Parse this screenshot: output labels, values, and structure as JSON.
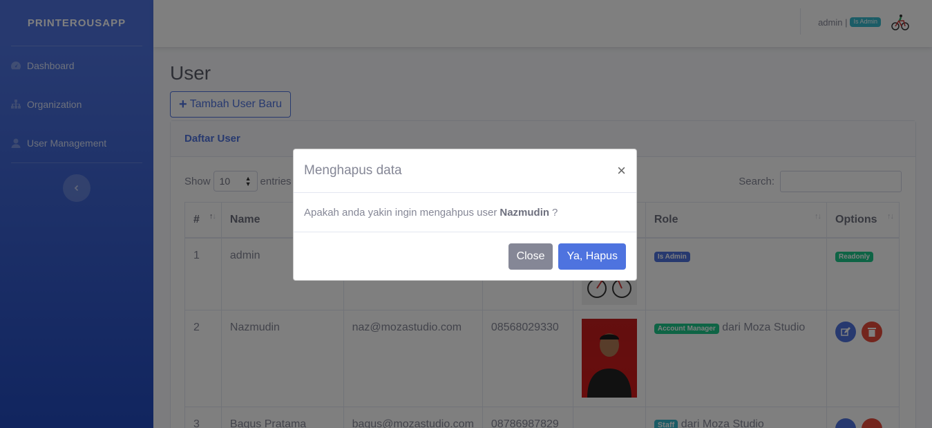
{
  "sidebar": {
    "brand": "PRINTEROUSAPP",
    "items": [
      {
        "label": "Dashboard",
        "icon": "tachometer-icon"
      },
      {
        "label": "Organization",
        "icon": "sitemap-icon"
      },
      {
        "label": "User Management",
        "icon": "user-icon"
      }
    ]
  },
  "topbar": {
    "username": "admin |",
    "role_badge": "Is Admin"
  },
  "page": {
    "title": "User",
    "add_button": "Tambah User Baru"
  },
  "card": {
    "title": "Daftar User",
    "show_label": "Show",
    "entries_value": "10",
    "entries_label": "entries",
    "search_label": "Search:"
  },
  "table": {
    "headers": {
      "num": "#",
      "name": "Name",
      "role": "Role",
      "options": "Options"
    },
    "rows": [
      {
        "num": "1",
        "name": "admin",
        "email": "",
        "phone": "",
        "role_badge": "Is Admin",
        "role_suffix": "",
        "option": "Readonly"
      },
      {
        "num": "2",
        "name": "Nazmudin",
        "email": "naz@mozastudio.com",
        "phone": "08568029330",
        "role_badge": "Account Manager",
        "role_suffix": "dari Moza Studio"
      },
      {
        "num": "3",
        "name": "Bagus Pratama",
        "email": "bagus@mozastudio.com",
        "phone": "08786987829",
        "role_badge": "Staff",
        "role_suffix": "dari Moza Studio"
      }
    ]
  },
  "modal": {
    "title": "Menghapus data",
    "close_symbol": "×",
    "message_prefix": "Apakah anda yakin ingin mengahpus user",
    "message_name": "Nazmudin",
    "message_suffix": "?",
    "close_button": "Close",
    "confirm_button": "Ya, Hapus"
  },
  "colors": {
    "primary": "#4e73df",
    "success": "#1cc88a",
    "info": "#36b9cc",
    "danger": "#e74a3b",
    "secondary": "#858796"
  }
}
